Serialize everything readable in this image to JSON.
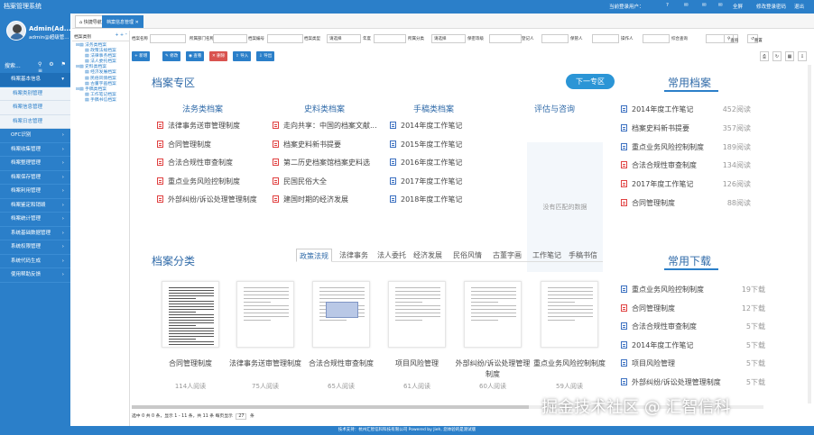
{
  "app": {
    "title": "档案管理系统"
  },
  "topbar": {
    "user": "当前登录用户：",
    "full": "全屏",
    "change_pwd": "修改登录密码",
    "logout": "退出",
    "badge_msg": "1",
    "badge_mail": "0",
    "badge_todo": "7"
  },
  "user": {
    "name": "Admin(Ad...",
    "role": "admin@超级管..."
  },
  "sidebar": {
    "search": "搜索...",
    "items": [
      {
        "label": "档案基本信息",
        "type": "top"
      },
      {
        "label": "档案类别管理",
        "type": "sub"
      },
      {
        "label": "档案信息管理",
        "type": "sub"
      },
      {
        "label": "档案日志管理",
        "type": "sub"
      },
      {
        "label": "OFC识别",
        "type": "main"
      },
      {
        "label": "档案收集管理",
        "type": "main"
      },
      {
        "label": "档案整理管理",
        "type": "main"
      },
      {
        "label": "档案保存管理",
        "type": "main"
      },
      {
        "label": "档案利用管理",
        "type": "main"
      },
      {
        "label": "档案鉴定和销毁",
        "type": "main"
      },
      {
        "label": "档案统计管理",
        "type": "main"
      },
      {
        "label": "系统基础数据管理",
        "type": "main"
      },
      {
        "label": "系统权限管理",
        "type": "main"
      },
      {
        "label": "系统代码生成",
        "type": "main"
      },
      {
        "label": "使用帮助反馈",
        "type": "main"
      }
    ]
  },
  "tabs": [
    {
      "label": "快捷导航"
    },
    {
      "label": "档案信息管理"
    }
  ],
  "tree": {
    "header": "档案类别",
    "nodes": [
      "法务类档案",
      "政策法规档案",
      "法律事务档案",
      "法人委托档案",
      "史料类档案",
      "经济发展档案",
      "民俗风情档案",
      "古董字画档案",
      "手稿类档案",
      "工作笔记档案",
      "手稿书信档案"
    ]
  },
  "filters": {
    "labels": [
      "档案名称",
      "所属部门名称",
      "档案编号",
      "档案类型",
      "年度",
      "所属分类",
      "保密等级",
      "登记人",
      "保管人",
      "操作人",
      "综合查询"
    ],
    "select_default": "请选择",
    "search": "查询",
    "reset": "重置"
  },
  "toolbar": {
    "add": "新增",
    "edit": "修改",
    "view": "查看",
    "delete": "删除",
    "import": "导入",
    "export": "导出"
  },
  "archive": {
    "title": "档案专区",
    "next_label": "下一专区",
    "columns": [
      {
        "title": "法务类档案",
        "items": [
          {
            "name": "法律事务送审管理制度",
            "icon": "pdf"
          },
          {
            "name": "合同管理制度",
            "icon": "pdf"
          },
          {
            "name": "合法合规性审查制度",
            "icon": "pdf"
          },
          {
            "name": "重点业务风险控制制度",
            "icon": "pdf"
          },
          {
            "name": "外部纠纷/诉讼处理管理制度",
            "icon": "pdf"
          }
        ]
      },
      {
        "title": "史料类档案",
        "items": [
          {
            "name": "走向共享：中国的档案文献...",
            "icon": "pdf"
          },
          {
            "name": "档案史料新书提要",
            "icon": "pdf"
          },
          {
            "name": "第二历史档案馆档案史料选",
            "icon": "pdf"
          },
          {
            "name": "民国民俗大全",
            "icon": "pdf"
          },
          {
            "name": "建国时期的经济发展",
            "icon": "pdf"
          }
        ]
      },
      {
        "title": "手稿类档案",
        "items": [
          {
            "name": "2014年度工作笔记",
            "icon": "word"
          },
          {
            "name": "2015年度工作笔记",
            "icon": "word"
          },
          {
            "name": "2016年度工作笔记",
            "icon": "word"
          },
          {
            "name": "2017年度工作笔记",
            "icon": "word"
          },
          {
            "name": "2018年度工作笔记",
            "icon": "word"
          }
        ]
      },
      {
        "title": "评估与咨询",
        "empty": "没有匹配的数据"
      }
    ]
  },
  "common_archive": {
    "title": "常用档案",
    "items": [
      {
        "name": "2014年度工作笔记",
        "count": "452阅读",
        "icon": "word"
      },
      {
        "name": "档案史料新书提要",
        "count": "357阅读",
        "icon": "word"
      },
      {
        "name": "重点业务风险控制制度",
        "count": "189阅读",
        "icon": "word"
      },
      {
        "name": "合法合规性审查制度",
        "count": "134阅读",
        "icon": "pdf"
      },
      {
        "name": "2017年度工作笔记",
        "count": "126阅读",
        "icon": "pdf"
      },
      {
        "name": "合同管理制度",
        "count": "88阅读",
        "icon": "pdf"
      }
    ]
  },
  "category": {
    "title": "档案分类",
    "tabs": [
      "政策法规",
      "法律事务",
      "法人委托",
      "经济发展",
      "民俗风情",
      "古董字画",
      "工作笔记",
      "手稿书信"
    ],
    "active_tab": "政策法规",
    "docs": [
      {
        "name": "合同管理制度",
        "reads": "114人阅读"
      },
      {
        "name": "法律事务送审管理制度",
        "reads": "75人阅读"
      },
      {
        "name": "合法合规性审查制度",
        "reads": "65人阅读"
      },
      {
        "name": "项目风险管理",
        "reads": "61人阅读"
      },
      {
        "name": "外部纠纷/诉讼处理管理制度",
        "reads": "60人阅读"
      },
      {
        "name": "重点业务风险控制制度",
        "reads": "59人阅读"
      }
    ]
  },
  "common_download": {
    "title": "常用下载",
    "items": [
      {
        "name": "重点业务风险控制制度",
        "count": "19下载",
        "icon": "word"
      },
      {
        "name": "合同管理制度",
        "count": "12下载",
        "icon": "pdf"
      },
      {
        "name": "合法合规性审查制度",
        "count": "5下载",
        "icon": "word"
      },
      {
        "name": "2014年度工作笔记",
        "count": "5下载",
        "icon": "word"
      },
      {
        "name": "项目风险管理",
        "count": "5下载",
        "icon": "word"
      },
      {
        "name": "外部纠纷/诉讼处理管理制度",
        "count": "5下载",
        "icon": "word"
      }
    ]
  },
  "pager": {
    "text": "选中 0 共 0 条，显示 1 - 11 条，共 11 条 每页显示",
    "size": "27",
    "suffix": "条"
  },
  "footer": "技术支持：杭州汇智信科科技有限公司 Powered by Jieh, 您体验的是测试版",
  "watermark": "掘金技术社区 @ 汇智信科"
}
